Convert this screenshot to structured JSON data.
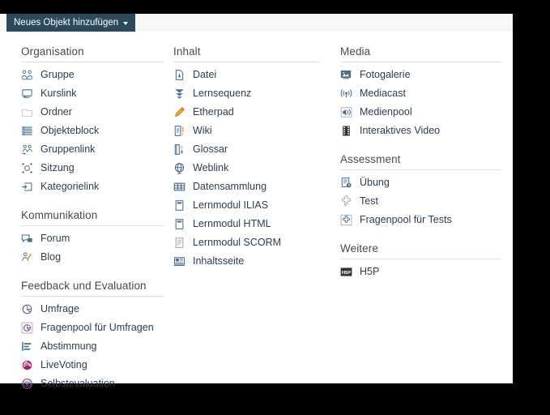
{
  "trigger": {
    "label": "Neues Objekt hinzufügen",
    "caret_icon": "caret-down-icon"
  },
  "colors": {
    "trigger_bg": "#2c4a5e",
    "trigger_text": "#ffffff",
    "panel_bg": "#ffffff",
    "page_bg": "#000000",
    "heading_text": "#444b52",
    "link_text": "#2c3e50",
    "divider": "#e0e0e0",
    "icon_blue": "#4a6d8c",
    "icon_orange": "#e8a33d",
    "icon_magenta": "#a4246a",
    "icon_purple": "#7a4a8c",
    "icon_dark": "#333333"
  },
  "columns": [
    {
      "name": "column-left",
      "groups": [
        {
          "heading": "Organisation",
          "items": [
            {
              "label": "Gruppe",
              "icon": "group-icon"
            },
            {
              "label": "Kurslink",
              "icon": "course-link-icon"
            },
            {
              "label": "Ordner",
              "icon": "folder-icon"
            },
            {
              "label": "Objekteblock",
              "icon": "object-block-icon"
            },
            {
              "label": "Gruppenlink",
              "icon": "group-link-icon"
            },
            {
              "label": "Sitzung",
              "icon": "session-icon"
            },
            {
              "label": "Kategorielink",
              "icon": "category-link-icon"
            }
          ]
        },
        {
          "heading": "Kommunikation",
          "items": [
            {
              "label": "Forum",
              "icon": "forum-icon"
            },
            {
              "label": "Blog",
              "icon": "blog-icon"
            }
          ]
        },
        {
          "heading": "Feedback und Evaluation",
          "items": [
            {
              "label": "Umfrage",
              "icon": "survey-icon"
            },
            {
              "label": "Fragenpool für Umfragen",
              "icon": "survey-pool-icon"
            },
            {
              "label": "Abstimmung",
              "icon": "poll-icon"
            },
            {
              "label": "LiveVoting",
              "icon": "livevoting-icon"
            },
            {
              "label": "Selbstevaluation",
              "icon": "self-evaluation-icon"
            }
          ]
        }
      ]
    },
    {
      "name": "column-middle",
      "groups": [
        {
          "heading": "Inhalt",
          "items": [
            {
              "label": "Datei",
              "icon": "file-icon"
            },
            {
              "label": "Lernsequenz",
              "icon": "learning-sequence-icon"
            },
            {
              "label": "Etherpad",
              "icon": "pencil-icon"
            },
            {
              "label": "Wiki",
              "icon": "wiki-icon"
            },
            {
              "label": "Glossar",
              "icon": "glossary-icon"
            },
            {
              "label": "Weblink",
              "icon": "weblink-icon"
            },
            {
              "label": "Datensammlung",
              "icon": "data-collection-icon"
            },
            {
              "label": "Lernmodul ILIAS",
              "icon": "learning-module-icon"
            },
            {
              "label": "Lernmodul HTML",
              "icon": "learning-module-icon"
            },
            {
              "label": "Lernmodul SCORM",
              "icon": "scorm-module-icon"
            },
            {
              "label": "Inhaltsseite",
              "icon": "content-page-icon"
            }
          ]
        }
      ]
    },
    {
      "name": "column-right",
      "groups": [
        {
          "heading": "Media",
          "items": [
            {
              "label": "Fotogalerie",
              "icon": "photo-gallery-icon"
            },
            {
              "label": "Mediacast",
              "icon": "mediacast-icon"
            },
            {
              "label": "Medienpool",
              "icon": "media-pool-icon"
            },
            {
              "label": "Interaktives Video",
              "icon": "interactive-video-icon"
            }
          ]
        },
        {
          "heading": "Assessment",
          "items": [
            {
              "label": "Übung",
              "icon": "exercise-icon"
            },
            {
              "label": "Test",
              "icon": "test-icon"
            },
            {
              "label": "Fragenpool für Tests",
              "icon": "question-pool-icon"
            }
          ]
        },
        {
          "heading": "Weitere",
          "items": [
            {
              "label": "H5P",
              "icon": "h5p-icon"
            }
          ]
        }
      ]
    }
  ]
}
